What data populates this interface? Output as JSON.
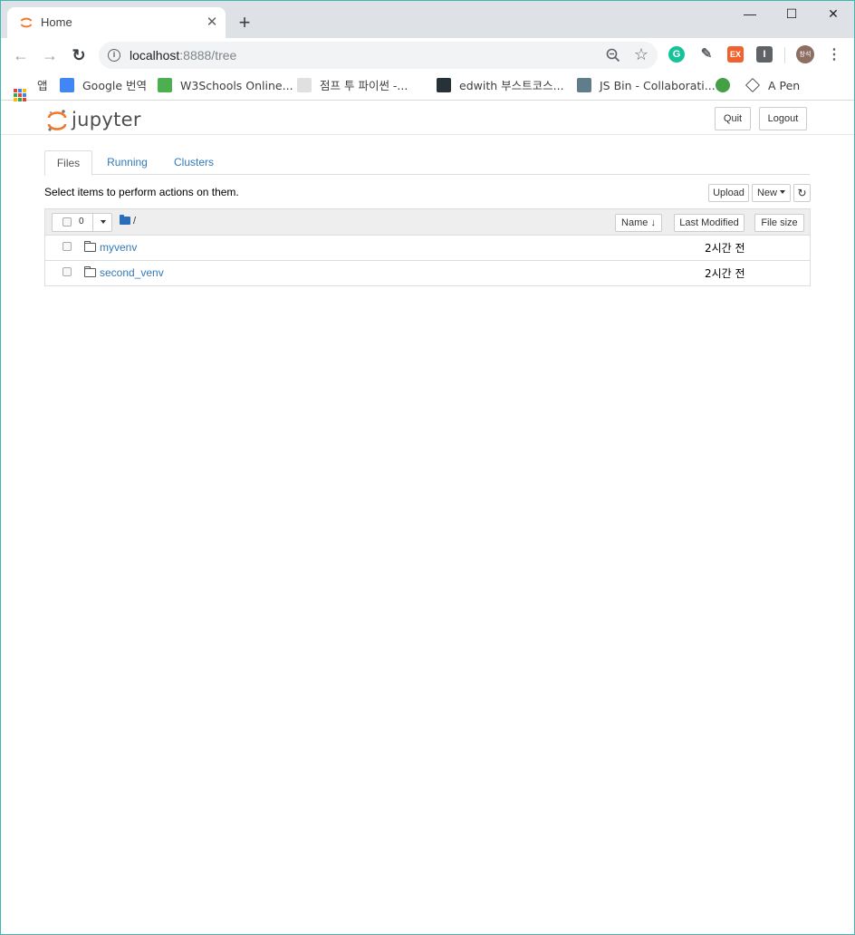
{
  "browser": {
    "tab": {
      "title": "Home",
      "close_glyph": "✕"
    },
    "new_tab_glyph": "+",
    "window_controls": {
      "minimize": "—",
      "maximize": "☐",
      "close": "✕"
    },
    "nav": {
      "back": "←",
      "forward": "→",
      "reload": "↻"
    },
    "omnibox": {
      "host": "localhost",
      "rest": ":8888/tree",
      "info_glyph": "i",
      "star_glyph": "☆"
    },
    "extensions": [
      {
        "name": "grammarly-icon",
        "glyph": "G",
        "color": "#15c39a"
      },
      {
        "name": "color-picker-icon",
        "glyph": "✎",
        "color": "#5f6368"
      },
      {
        "name": "ex-extension-icon",
        "glyph": "EX",
        "color": "#f0612d"
      },
      {
        "name": "i-extension-icon",
        "glyph": "I",
        "color": "#5f6368"
      }
    ],
    "avatar_text": "창석",
    "menu_glyph": "⋮"
  },
  "bookmarks": [
    {
      "label": "앱",
      "icon": "apps-grid-icon"
    },
    {
      "label": "Google 번역",
      "icon": "google-translate-icon",
      "color": "#4285f4"
    },
    {
      "label": "W3Schools Online...",
      "icon": "w3schools-icon",
      "color": "#4caf50"
    },
    {
      "label": "점프 투 파이썬 -...",
      "icon": "wikidocs-icon",
      "color": "#9e9e9e"
    },
    {
      "label": "edwith 부스트코스...",
      "icon": "edwith-icon",
      "color": "#263238"
    },
    {
      "label": "JS Bin - Collaborati...",
      "icon": "jsbin-icon",
      "color": "#607d8b"
    },
    {
      "label": "",
      "icon": "globe-bookmark-icon",
      "color": "#43a047"
    },
    {
      "label": "A Pen",
      "icon": "codepen-icon",
      "color": "#111111"
    }
  ],
  "jupyter": {
    "logo_text": "jupyter",
    "buttons": {
      "quit": "Quit",
      "logout": "Logout"
    },
    "tabs": [
      {
        "label": "Files",
        "active": true
      },
      {
        "label": "Running",
        "active": false
      },
      {
        "label": "Clusters",
        "active": false
      }
    ],
    "instructions": "Select items to perform actions on them.",
    "actions": {
      "upload": "Upload",
      "new": "New",
      "refresh_glyph": "↻"
    },
    "list": {
      "selected_count": "0",
      "path": "/",
      "sort": {
        "name": "Name",
        "name_arrow": "🡓",
        "modified": "Last Modified",
        "size": "File size"
      },
      "rows": [
        {
          "name": "myvenv",
          "modified": "2시간 전"
        },
        {
          "name": "second_venv",
          "modified": "2시간 전"
        }
      ]
    }
  },
  "colors": {
    "accent_link": "#337ab7",
    "jupyter_orange": "#f37726",
    "chrome_tabbar": "#dee1e6",
    "window_border": "#3fb6b4"
  }
}
